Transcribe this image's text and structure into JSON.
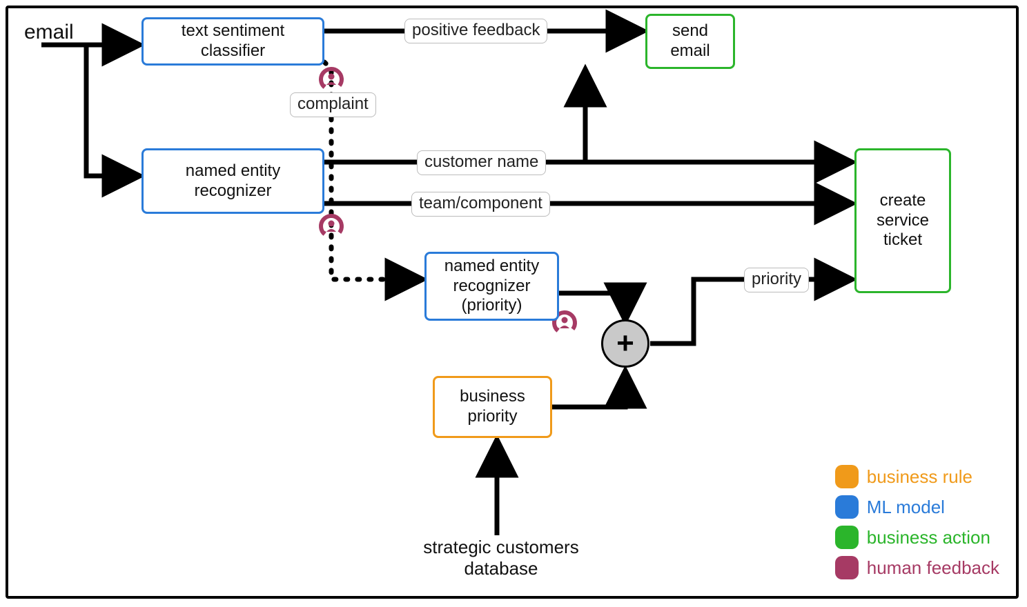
{
  "input_label": "email",
  "nodes": {
    "text_sentiment": "text sentiment classifier",
    "ner": "named entity recognizer",
    "ner_priority": "named entity recognizer (priority)",
    "biz_priority": "business priority",
    "send_email": "send email",
    "create_ticket": "create service ticket"
  },
  "edge_labels": {
    "positive_feedback": "positive feedback",
    "complaint": "complaint",
    "customer_name": "customer name",
    "team_component": "team/component",
    "priority": "priority"
  },
  "source_label": "strategic customers database",
  "legend": {
    "business_rule": "business rule",
    "ml_model": "ML model",
    "business_action": "business action",
    "human_feedback": "human feedback"
  },
  "colors": {
    "ml": "#2a7bd9",
    "business_rule": "#f09a1a",
    "business_action": "#2bb52b",
    "human_feedback": "#a63a64"
  }
}
